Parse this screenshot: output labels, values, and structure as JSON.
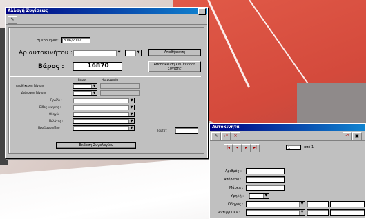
{
  "main_window": {
    "title": "Αλλαγή Ζυγίσεως",
    "date_label": "Ημερομηνία:",
    "date_value": "30/6/2002",
    "vehicle_label": "Αρ.αυτοκινήτου :",
    "weight_label": "Βάρος :",
    "weight_value": "16870",
    "save_button": "Αποθήκευση",
    "save_print_button": "Αποθήκευση και Έκδοση ζύγισης",
    "col_weight": "Βάρος",
    "col_date": "Ημερομηνία",
    "save_weighing_label": "Αποθήκευση ζύγισης :",
    "delete_weighing_label": "Διάγραφη ζύγισης :",
    "product_label": "Προϊόν :",
    "subtype_label": "Είδος κίνησης :",
    "driver_label": "Οδηγός :",
    "customer_label": "Πελάτης :",
    "source_label": "Προέλευση/Προ :",
    "ticket_label": "Ταυτότ :",
    "issue_button": "Έκδοση Ζυγολογίου"
  },
  "vehicles_window": {
    "title": "Αυτοκίνητα",
    "record_current": "1",
    "record_of": "από 1",
    "number_label": "Αριθμός :",
    "tare_label": "Απόβαρο :",
    "brand_label": "Μάρκα :",
    "type_label": "Υψηλή :",
    "driver_label": "Οδηγός :",
    "trailer_label": "Αντιρρ.Πελ :"
  },
  "colors": {
    "title_start": "#000080",
    "title_end": "#1084d0",
    "window_face": "#c0c0c0",
    "court": "#e15a48"
  }
}
